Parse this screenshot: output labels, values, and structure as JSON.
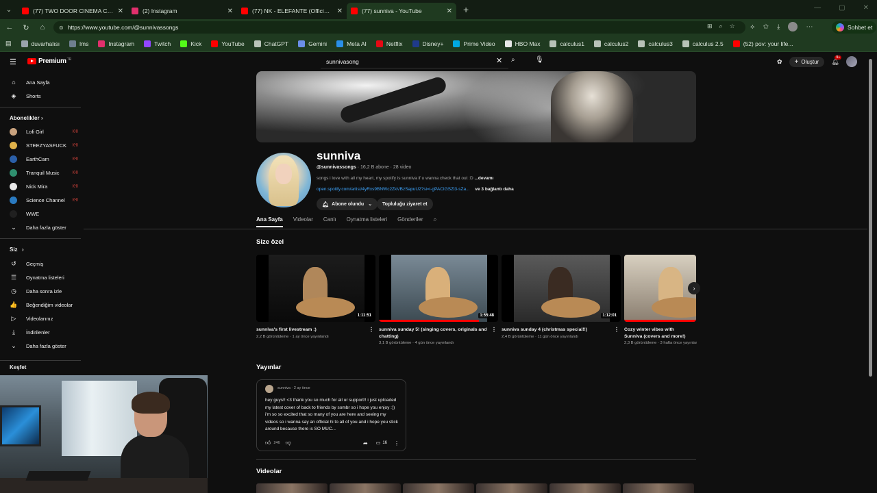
{
  "browser": {
    "tabs": [
      {
        "title": "(77) TWO DOOR CINEMA CLUB | S",
        "color": "#ff0000",
        "active": false
      },
      {
        "title": "(2) Instagram",
        "color": "#e1306c",
        "active": false
      },
      {
        "title": "(77) NK - ELEFANTE (Official Video",
        "color": "#ff0000",
        "active": false
      },
      {
        "title": "(77) sunniva - YouTube",
        "color": "#ff0000",
        "active": true
      }
    ],
    "url": "https://www.youtube.com/@sunnivassongs",
    "copilot_label": "Sohbet et",
    "bookmarks": [
      {
        "label": "duvarhalısı",
        "color": "#9aa3ad"
      },
      {
        "label": "lms",
        "color": "#6e7f8f"
      },
      {
        "label": "Instagram",
        "color": "#e1306c"
      },
      {
        "label": "Twitch",
        "color": "#9146ff"
      },
      {
        "label": "Kick",
        "color": "#53fc18"
      },
      {
        "label": "YouTube",
        "color": "#ff0000"
      },
      {
        "label": "ChatGPT",
        "color": "#b8c2b8"
      },
      {
        "label": "Gemini",
        "color": "#6b8ee8"
      },
      {
        "label": "Meta AI",
        "color": "#2a8fe8"
      },
      {
        "label": "Netflix",
        "color": "#e50914"
      },
      {
        "label": "Disney+",
        "color": "#1f3a8a"
      },
      {
        "label": "Prime Video",
        "color": "#00a8e1"
      },
      {
        "label": "HBO Max",
        "color": "#e8e8e8"
      },
      {
        "label": "calculus1",
        "color": "#b8c2b8"
      },
      {
        "label": "calculus2",
        "color": "#b8c2b8"
      },
      {
        "label": "calculus3",
        "color": "#b8c2b8"
      },
      {
        "label": "calculus 2.5",
        "color": "#b8c2b8"
      },
      {
        "label": "(52) pov: your life...",
        "color": "#ff0000"
      }
    ]
  },
  "youtube": {
    "logo": "Premium",
    "logo_sup": "TR",
    "search_value": "sunnivasong",
    "create_label": "Oluştur",
    "notif_count": "9+",
    "sidebar": {
      "main": [
        {
          "label": "Ana Sayfa",
          "icon": "home-icon",
          "glyph": "⌂"
        },
        {
          "label": "Shorts",
          "icon": "shorts-icon",
          "glyph": "◈"
        }
      ],
      "subs_title": "Abonelikler",
      "subs": [
        {
          "label": "Lofi Girl",
          "color": "#c9a27e"
        },
        {
          "label": "STEEZYASFUCK",
          "color": "#e0b24a"
        },
        {
          "label": "EarthCam",
          "color": "#2b5fa8"
        },
        {
          "label": "Tranquil Music",
          "color": "#2f8f6f"
        },
        {
          "label": "Nick Mira",
          "color": "#e8e8e8"
        },
        {
          "label": "Science Channel",
          "color": "#2a7ac0"
        },
        {
          "label": "WWE",
          "color": "#202020"
        }
      ],
      "subs_more": "Daha fazla göster",
      "you_title": "Siz",
      "you": [
        {
          "label": "Geçmiş",
          "icon": "history-icon",
          "glyph": "↺"
        },
        {
          "label": "Oynatma listeleri",
          "icon": "playlists-icon",
          "glyph": "☰"
        },
        {
          "label": "Daha sonra izle",
          "icon": "watch-later-icon",
          "glyph": "◷"
        },
        {
          "label": "Beğendiğim videolar",
          "icon": "liked-icon",
          "glyph": "👍"
        },
        {
          "label": "Videolarınız",
          "icon": "your-videos-icon",
          "glyph": "▷"
        },
        {
          "label": "İndirilenler",
          "icon": "downloads-icon",
          "glyph": "⤓"
        },
        {
          "label": "Daha fazla göster",
          "icon": "chevron-down-icon",
          "glyph": "⌄"
        }
      ],
      "explore_title": "Keşfet"
    },
    "channel": {
      "name": "sunniva",
      "handle": "@sunnivassongs",
      "stats": "· 16,2 B abone · 28 video",
      "description": "songs i love with all my heart, my spotify is sunniva if u wanna check that out :D",
      "description_more": "...devamı",
      "link": "open.spotify.com/artist/4yRxs9BNWc2ZkVBzSapuU2?si=i-gPACIGSZi3-sZa...",
      "link_more": "ve 3 bağlantı daha",
      "subscribed_label": "Abone olundu",
      "community_label": "Topluluğu ziyaret et"
    },
    "tabs": [
      "Ana Sayfa",
      "Videolar",
      "Canlı",
      "Oynatma listeleri",
      "Gönderiler"
    ],
    "for_you_title": "Size özel",
    "videos": [
      {
        "title": "sunniva's first livestream :)",
        "meta": "2,2 B görüntüleme · 1 ay önce yayınlandı",
        "duration": "1:11:51",
        "progress": 0
      },
      {
        "title": "sunniva sunday 5! (singing covers, originals and chatting)",
        "meta": "3,1 B görüntüleme · 4 gün önce yayınlandı",
        "duration": "1:55:48",
        "progress": 0.84
      },
      {
        "title": "sunniva sunday 4 (christmas special!!)",
        "meta": "2,4 B görüntüleme · 11 gün önce yayınlandı",
        "duration": "1:12:01",
        "progress": 0
      },
      {
        "title": "Cozy winter vibes with Sunniva (covers and more!)",
        "meta": "2,3 B görüntüleme · 3 hafta önce yayınlandı",
        "duration": "",
        "progress": 1
      }
    ],
    "posts_title": "Yayınlar",
    "post": {
      "author": "sunniva",
      "time": "· 2 ay önce",
      "text": "hey guys!! <3 thank you so much for all ur support!! i just uploaded my latest cover of back to friends by sombr so i hope you enjoy :)) i'm so so excited that so many of you are here and seeing my videos so i wanna say an official hi to all of you and i hope you stick around because there is SO MUC...",
      "likes": "246",
      "comments": "16"
    },
    "videos_title": "Videolar"
  }
}
